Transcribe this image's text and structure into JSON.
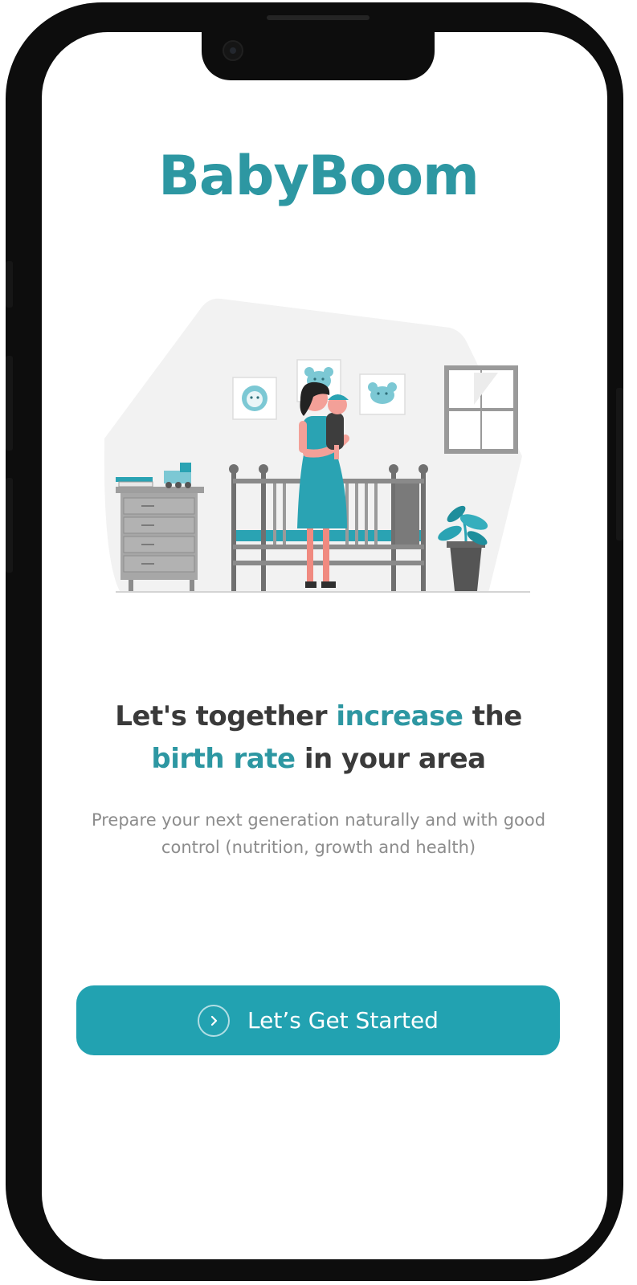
{
  "app": {
    "name": "BabyBoom"
  },
  "hero": {
    "illustration_name": "mother-holding-baby-in-nursery"
  },
  "headline": {
    "part1": "Let's together ",
    "highlight1": "increase",
    "part2": " the",
    "highlight2": "birth rate",
    "part3": " in your area"
  },
  "subtitle": "Prepare your next generation naturally and with good control (nutrition, growth and health)",
  "cta": {
    "label": "Let’s Get Started",
    "icon": "chevron-right-circle-icon"
  },
  "colors": {
    "brand": "#2d97a2",
    "button": "#22a2b1",
    "headline_text": "#3a3a3a",
    "subtitle_text": "#8c8c8c"
  }
}
